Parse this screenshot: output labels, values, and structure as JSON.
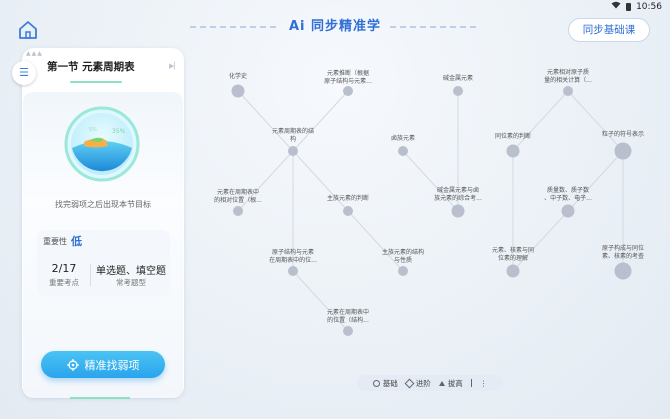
{
  "status": {
    "time": "10:56"
  },
  "header": {
    "title": "Ai 同步精准学",
    "sync_button": "同步基础课"
  },
  "sidebar": {
    "section_title": "第一节 元素周期表",
    "hint": "找完弱项之后出现本节目标",
    "importance_label": "重要性",
    "importance_value": "低",
    "points_value": "2/17",
    "points_label": "重要考点",
    "types_value": "单选题、填空题",
    "types_label": "常考题型",
    "find_button": "精准找弱项"
  },
  "graph": {
    "nodes": [
      {
        "id": "n1",
        "label": "化学史"
      },
      {
        "id": "n2",
        "label": "元素推断（根据\n原子结构与元素..."
      },
      {
        "id": "n3",
        "label": "元素周期表的结\n构"
      },
      {
        "id": "n4",
        "label": "元素在周期表中\n的相对位置（根..."
      },
      {
        "id": "n5",
        "label": "主族元素的判断"
      },
      {
        "id": "n6",
        "label": "原子结构与元素\n在周期表中的位..."
      },
      {
        "id": "n7",
        "label": "主族元素的结构\n与性质"
      },
      {
        "id": "n8",
        "label": "元素在周期表中\n的位置（结构..."
      },
      {
        "id": "n9",
        "label": "碱金属元素"
      },
      {
        "id": "n10",
        "label": "卤族元素"
      },
      {
        "id": "n11",
        "label": "碱金属元素与卤\n族元素的综合考..."
      },
      {
        "id": "n12",
        "label": "元素相对原子质\n量的相关计算（..."
      },
      {
        "id": "n13",
        "label": "同位素的判断"
      },
      {
        "id": "n14",
        "label": "粒子的符号表示"
      },
      {
        "id": "n15",
        "label": "质量数、质子数\n、中子数、电子..."
      },
      {
        "id": "n16",
        "label": "元素、核素与同\n位素的理解"
      },
      {
        "id": "n17",
        "label": "原子构成与同位\n素、核素的考查"
      }
    ]
  },
  "legend": {
    "basic": "基础",
    "advanced": "进阶",
    "improve": "拔高"
  }
}
